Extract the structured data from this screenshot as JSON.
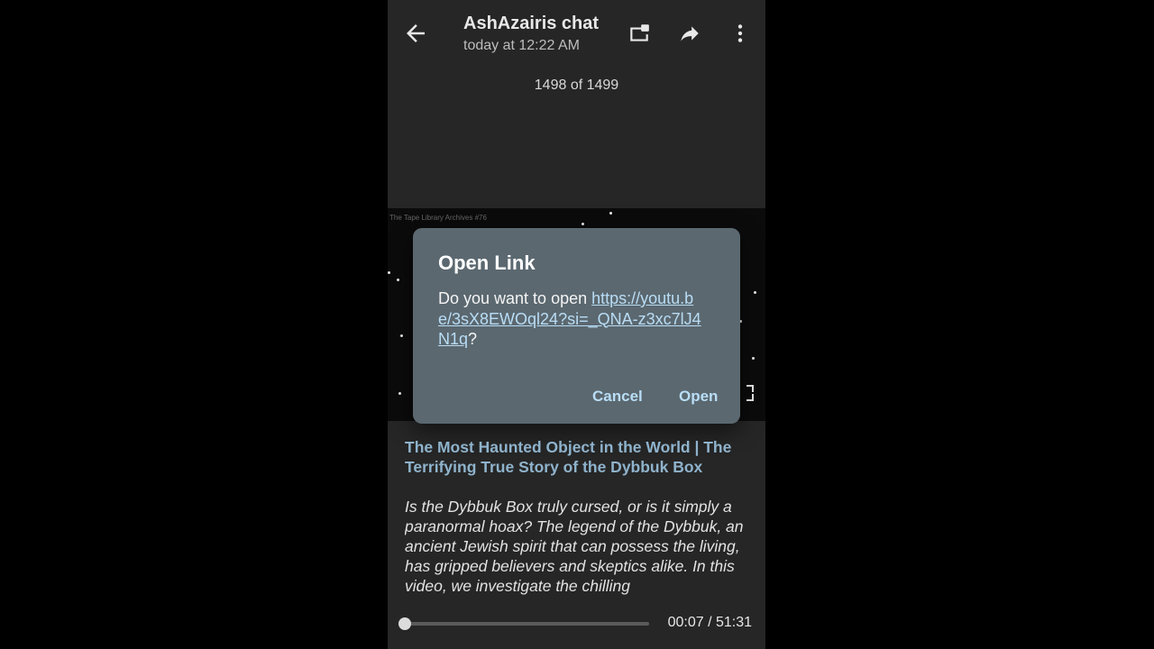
{
  "header": {
    "title": "AshAzairis chat",
    "subtitle": "today at 12:22 AM",
    "icons": [
      "back-arrow-icon",
      "picture-in-picture-icon",
      "share-forward-icon",
      "more-vertical-icon"
    ]
  },
  "counter": "1498 of 1499",
  "video": {
    "overlay_text": "The Tape Library Archives #76"
  },
  "dialog": {
    "title": "Open Link",
    "prompt": "Do you want to open ",
    "url": "https://youtu.be/3sX8EWOql24?si=_QNA-z3xc7lJ4N1q",
    "suffix": "?",
    "cancel_label": "Cancel",
    "open_label": "Open"
  },
  "content": {
    "title": "The Most Haunted Object in the World | The Terrifying True Story of the Dybbuk Box",
    "description": "Is the Dybbuk Box truly cursed, or is it simply a paranormal hoax? The legend of the Dybbuk, an ancient Jewish spirit that can possess the living, has gripped believers and skeptics alike. In this video, we investigate the chilling"
  },
  "player": {
    "time": "00:07 / 51:31",
    "progress_fraction": 0.0023
  },
  "colors": {
    "screen_bg": "#262626",
    "dialog_bg": "#5b6870",
    "link": "#b9ddf5",
    "title_link": "#8fb3cc"
  }
}
